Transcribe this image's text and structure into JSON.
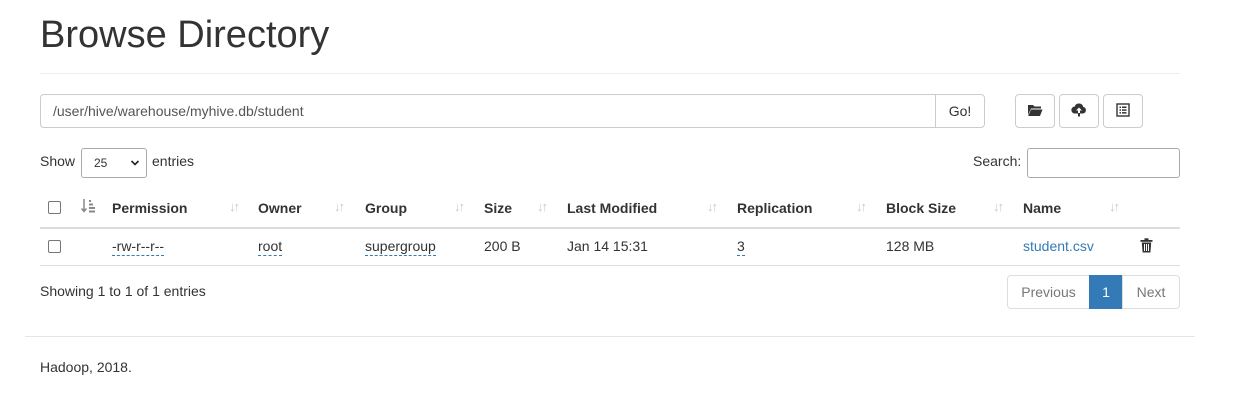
{
  "page": {
    "title": "Browse Directory"
  },
  "path_bar": {
    "value": "/user/hive/warehouse/myhive.db/student",
    "go_label": "Go!"
  },
  "toolbar": {
    "icons": [
      "folder-open-icon",
      "upload-icon",
      "list-icon"
    ]
  },
  "entries": {
    "show_label": "Show",
    "selected": "25",
    "suffix_label": "entries"
  },
  "search": {
    "label": "Search:",
    "value": ""
  },
  "table": {
    "columns": [
      "Permission",
      "Owner",
      "Group",
      "Size",
      "Last Modified",
      "Replication",
      "Block Size",
      "Name"
    ],
    "rows": [
      {
        "permission": "-rw-r--r--",
        "owner": "root",
        "group": "supergroup",
        "size": "200 B",
        "last_modified": "Jan 14 15:31",
        "replication": "3",
        "block_size": "128 MB",
        "name": "student.csv"
      }
    ]
  },
  "info": "Showing 1 to 1 of 1 entries",
  "pagination": {
    "previous": "Previous",
    "current": "1",
    "next": "Next"
  },
  "footer": "Hadoop, 2018.",
  "colors": {
    "link": "#337ab7",
    "active_page": "#337ab7"
  }
}
